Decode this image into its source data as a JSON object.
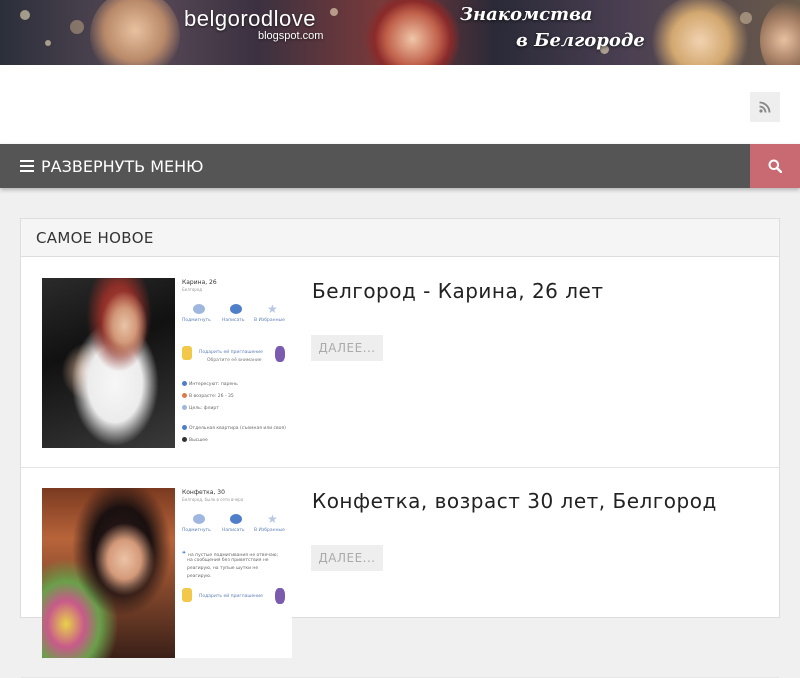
{
  "banner": {
    "logo": "belgorodlove",
    "logo_sub": "blogspot.com",
    "slogan_line1": "Знакомства",
    "slogan_line2": "в Белгороде"
  },
  "header": {
    "rss_icon": "rss-icon"
  },
  "menu": {
    "toggle_label": "РАЗВЕРНУТЬ МЕНЮ",
    "toggle_icon": "hamburger-icon",
    "search_icon": "search-icon",
    "search_color": "#c96a72",
    "bar_color": "#555555"
  },
  "section": {
    "title": "САМОЕ НОВОЕ"
  },
  "posts": [
    {
      "title": "Белгород - Карина, 26 лет",
      "more_label": "ДАЛЕЕ...",
      "card": {
        "name": "Карина, 26",
        "sub": "Белгород",
        "actions": [
          "Подмигнуть",
          "Написать",
          "В Избранные"
        ],
        "gift_line1": "Подарить ей приглашение",
        "gift_line2": "Обратите её внимание",
        "lines": [
          "Интересуют: парень",
          "В возрасте: 26 - 35",
          "Цель: флирт",
          "Отдельная квартира (съемная или своя)",
          "Высшее"
        ]
      }
    },
    {
      "title": "Конфетка, возраст 30 лет, Белгород",
      "more_label": "ДАЛЕЕ...",
      "card": {
        "name": "Конфетка, 30",
        "sub": "Белгород, было в сети вчера",
        "actions": [
          "Подмигнуть",
          "Написать",
          "В Избранные"
        ],
        "quote_lines": [
          "на пустые подмигивания не отвечаю;",
          "на сообщения без приветствия не",
          "реагирую, на тупые шутки не",
          "реагирую."
        ],
        "gift_line1": "Подарить ей приглашение"
      }
    }
  ]
}
